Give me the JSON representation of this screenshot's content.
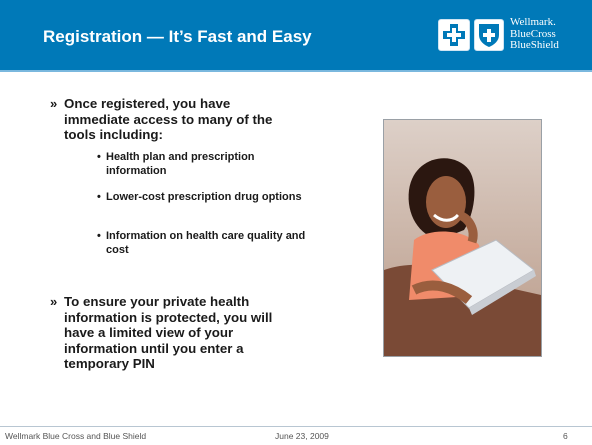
{
  "header": {
    "title": "Registration — It’s Fast and Easy",
    "logo_lines": [
      "Wellmark.",
      "BlueCross",
      "BlueShield"
    ]
  },
  "content": {
    "bullet1": "Once registered, you have immediate access to many of the tools including:",
    "sub_bullets": [
      "Health plan and prescription information",
      "Lower-cost prescription drug options",
      "Information on health care quality and cost"
    ],
    "bullet2": "To ensure your private health information is protected, you will have a limited view of your information until you enter a temporary PIN",
    "bullet_marker": "»",
    "sub_marker": "•"
  },
  "footer": {
    "left": "Wellmark Blue Cross and Blue Shield",
    "date": "June 23, 2009",
    "page": "6"
  },
  "colors": {
    "header_blue": "#0079b8",
    "text": "#1a1a1a"
  },
  "icons": [
    "blue-cross-logo-icon",
    "blue-shield-logo-icon"
  ]
}
